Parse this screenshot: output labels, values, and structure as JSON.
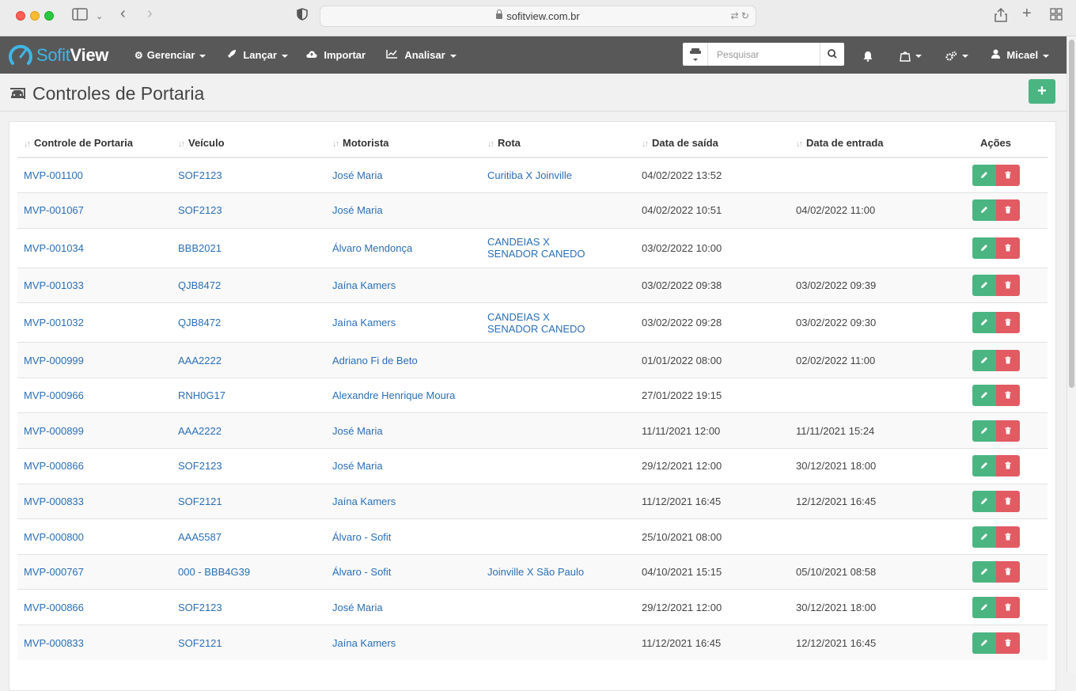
{
  "browser": {
    "url": "sofitview.com.br"
  },
  "app": {
    "logo_a": "Sofit",
    "logo_b": "View",
    "nav": [
      {
        "label": "Gerenciar"
      },
      {
        "label": "Lançar"
      },
      {
        "label": "Importar"
      },
      {
        "label": "Analisar"
      }
    ],
    "search_placeholder": "Pesquisar",
    "user": "Micael"
  },
  "page": {
    "title": "Controles de Portaria",
    "add_label": "+"
  },
  "table": {
    "headers": [
      "Controle de Portaria",
      "Veículo",
      "Motorista",
      "Rota",
      "Data de saída",
      "Data de entrada",
      "Ações"
    ],
    "rows": [
      {
        "controle": "MVP-001100",
        "veiculo": "SOF2123",
        "motorista": "José Maria",
        "rota": "Curitiba X Joinville",
        "saida": "04/02/2022 13:52",
        "entrada": ""
      },
      {
        "controle": "MVP-001067",
        "veiculo": "SOF2123",
        "motorista": "José Maria",
        "rota": "",
        "saida": "04/02/2022 10:51",
        "entrada": "04/02/2022 11:00"
      },
      {
        "controle": "MVP-001034",
        "veiculo": "BBB2021",
        "motorista": "Álvaro Mendonça",
        "rota": "CANDEIAS X SENADOR CANEDO",
        "saida": "03/02/2022 10:00",
        "entrada": ""
      },
      {
        "controle": "MVP-001033",
        "veiculo": "QJB8472",
        "motorista": "Jaína Kamers",
        "rota": "",
        "saida": "03/02/2022 09:38",
        "entrada": "03/02/2022 09:39"
      },
      {
        "controle": "MVP-001032",
        "veiculo": "QJB8472",
        "motorista": "Jaína Kamers",
        "rota": "CANDEIAS X SENADOR CANEDO",
        "saida": "03/02/2022 09:28",
        "entrada": "03/02/2022 09:30"
      },
      {
        "controle": "MVP-000999",
        "veiculo": "AAA2222",
        "motorista": "Adriano Fi de Beto",
        "rota": "",
        "saida": "01/01/2022 08:00",
        "entrada": "02/02/2022 11:00"
      },
      {
        "controle": "MVP-000966",
        "veiculo": "RNH0G17",
        "motorista": "Alexandre Henrique Moura",
        "rota": "",
        "saida": "27/01/2022 19:15",
        "entrada": ""
      },
      {
        "controle": "MVP-000899",
        "veiculo": "AAA2222",
        "motorista": "José Maria",
        "rota": "",
        "saida": "11/11/2021 12:00",
        "entrada": "11/11/2021 15:24"
      },
      {
        "controle": "MVP-000866",
        "veiculo": "SOF2123",
        "motorista": "José Maria",
        "rota": "",
        "saida": "29/12/2021 12:00",
        "entrada": "30/12/2021 18:00"
      },
      {
        "controle": "MVP-000833",
        "veiculo": "SOF2121",
        "motorista": "Jaína Kamers",
        "rota": "",
        "saida": "11/12/2021 16:45",
        "entrada": "12/12/2021 16:45"
      },
      {
        "controle": "MVP-000800",
        "veiculo": "AAA5587",
        "motorista": "Álvaro - Sofit",
        "rota": "",
        "saida": "25/10/2021 08:00",
        "entrada": ""
      },
      {
        "controle": "MVP-000767",
        "veiculo": "000 - BBB4G39",
        "motorista": "Álvaro - Sofit",
        "rota": "Joinville X São Paulo",
        "saida": "04/10/2021 15:15",
        "entrada": "05/10/2021 08:58"
      },
      {
        "controle": "MVP-000866",
        "veiculo": "SOF2123",
        "motorista": "José Maria",
        "rota": "",
        "saida": "29/12/2021 12:00",
        "entrada": "30/12/2021 18:00"
      },
      {
        "controle": "MVP-000833",
        "veiculo": "SOF2121",
        "motorista": "Jaína Kamers",
        "rota": "",
        "saida": "11/12/2021 16:45",
        "entrada": "12/12/2021 16:45"
      }
    ]
  },
  "colors": {
    "navbar": "#585858",
    "accent_green": "#4bb582",
    "accent_red": "#e25b63",
    "link": "#2a6fb5",
    "logo_blue": "#3fb6e6"
  },
  "icons": [
    "sidebar-icon",
    "back-icon",
    "forward-icon",
    "shield-icon",
    "translate-icon",
    "reload-icon",
    "share-icon",
    "new-tab-icon",
    "tabs-grid-icon",
    "gauge-logo-icon",
    "gear-icon",
    "rocket-icon",
    "cloud-upload-icon",
    "line-chart-icon",
    "car-icon",
    "search-icon",
    "bell-icon",
    "bag-icon",
    "cogs-icon",
    "user-icon",
    "pencil-icon",
    "trash-icon",
    "sort-icon"
  ]
}
